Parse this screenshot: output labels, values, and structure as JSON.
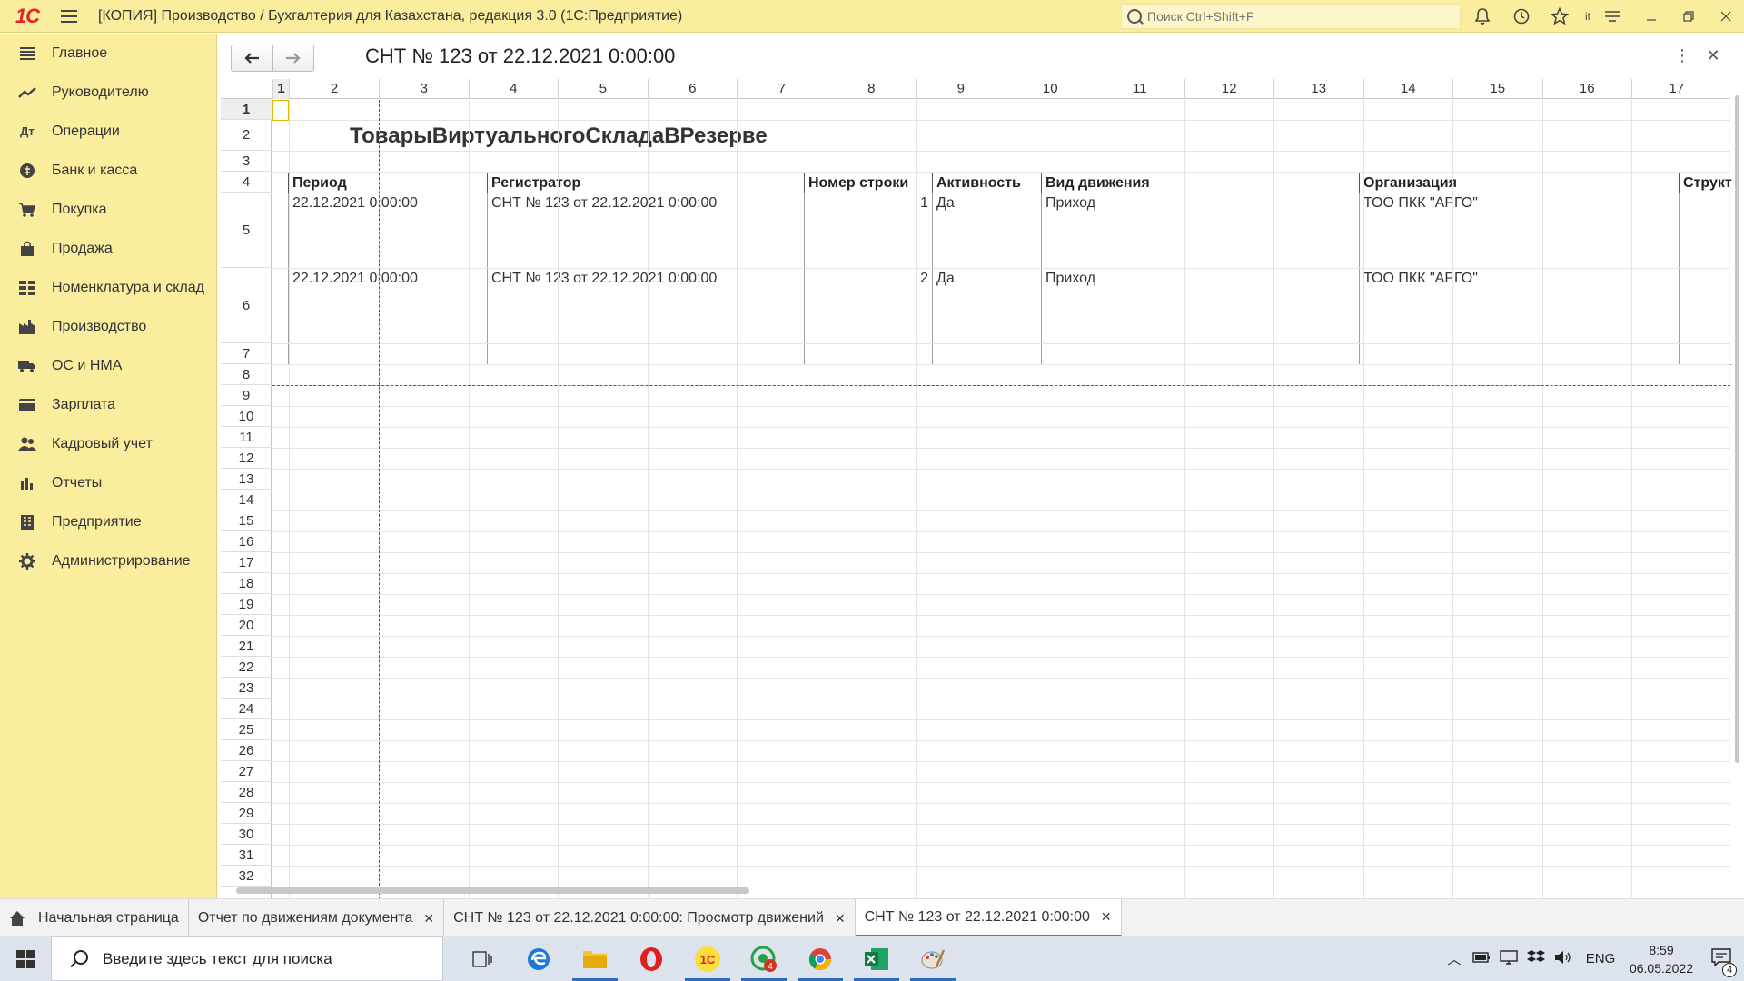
{
  "app": {
    "title": "[КОПИЯ] Производство / Бухгалтерия для Казахстана, редакция 3.0  (1С:Предприятие)",
    "logo": "1С",
    "search_placeholder": "Поиск Ctrl+Shift+F"
  },
  "sidebar": {
    "items": [
      {
        "label": "Главное",
        "icon": "menu-icon"
      },
      {
        "label": "Руководителю",
        "icon": "trend-icon"
      },
      {
        "label": "Операции",
        "icon": "operations-icon"
      },
      {
        "label": "Банк и касса",
        "icon": "bank-icon"
      },
      {
        "label": "Покупка",
        "icon": "cart-icon"
      },
      {
        "label": "Продажа",
        "icon": "bag-icon"
      },
      {
        "label": "Номенклатура и склад",
        "icon": "warehouse-icon"
      },
      {
        "label": "Производство",
        "icon": "factory-icon"
      },
      {
        "label": "ОС и НМА",
        "icon": "truck-icon"
      },
      {
        "label": "Зарплата",
        "icon": "wallet-icon"
      },
      {
        "label": "Кадровый учет",
        "icon": "people-icon"
      },
      {
        "label": "Отчеты",
        "icon": "bar-chart-icon"
      },
      {
        "label": "Предприятие",
        "icon": "building-icon"
      },
      {
        "label": "Администрирование",
        "icon": "gear-icon"
      }
    ]
  },
  "document": {
    "title": "СНТ № 123 от 22.12.2021 0:00:00"
  },
  "grid": {
    "columns": [
      "1",
      "2",
      "3",
      "4",
      "5",
      "6",
      "7",
      "8",
      "9",
      "10",
      "11",
      "12",
      "13",
      "14",
      "15",
      "16",
      "17"
    ],
    "rows": [
      "1",
      "2",
      "3",
      "4",
      "5",
      "6",
      "7",
      "8",
      "9",
      "10",
      "11",
      "12",
      "13",
      "14",
      "15",
      "16",
      "17",
      "18",
      "19",
      "20",
      "21",
      "22",
      "23",
      "24",
      "25",
      "26",
      "27",
      "28",
      "29",
      "30",
      "31",
      "32"
    ]
  },
  "report": {
    "title": "ТоварыВиртуальногоСкладаВРезерве",
    "headers": [
      "Период",
      "Регистратор",
      "Номер строки",
      "Активность",
      "Вид движения",
      "Организация",
      "Структ"
    ],
    "rows": [
      [
        "22.12.2021 0:00:00",
        "СНТ № 123 от 22.12.2021 0:00:00",
        "1",
        "Да",
        "Приход",
        "ТОО  ПКК \"АРГО\"",
        ""
      ],
      [
        "22.12.2021 0:00:00",
        "СНТ № 123 от 22.12.2021 0:00:00",
        "2",
        "Да",
        "Приход",
        "ТОО  ПКК \"АРГО\"",
        ""
      ]
    ]
  },
  "tabs": [
    {
      "label": "Начальная страница",
      "closable": false
    },
    {
      "label": "Отчет по движениям документа",
      "closable": true
    },
    {
      "label": "СНТ № 123 от 22.12.2021 0:00:00: Просмотр движений",
      "closable": true
    },
    {
      "label": "СНТ № 123 от 22.12.2021 0:00:00",
      "closable": true,
      "active": true
    }
  ],
  "taskbar": {
    "search_text": "Введите здесь текст для поиска",
    "lang": "ENG",
    "time": "8:59",
    "date": "06.05.2022",
    "notif_count": "4",
    "whatsapp_badge": "4"
  }
}
